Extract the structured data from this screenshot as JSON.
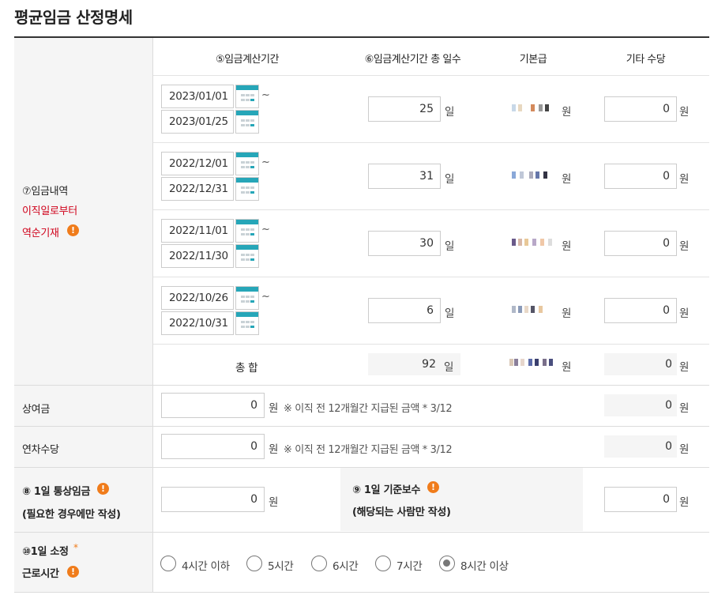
{
  "title": "평균임금 산정명세",
  "headers": {
    "period": "⑤임금계산기간",
    "days": "⑥임금계산기간 총 일수",
    "base_pay": "기본급",
    "other_allowance": "기타 수당"
  },
  "wage_section": {
    "label_line1": "⑦임금내역",
    "label_line2": "이직일로부터",
    "label_line3": "역순기재"
  },
  "periods": [
    {
      "start": "2023/01/01",
      "end": "2023/01/25",
      "days": "25",
      "other": "0"
    },
    {
      "start": "2022/12/01",
      "end": "2022/12/31",
      "days": "31",
      "other": "0"
    },
    {
      "start": "2022/11/01",
      "end": "2022/11/30",
      "days": "30",
      "other": "0"
    },
    {
      "start": "2022/10/26",
      "end": "2022/10/31",
      "days": "6",
      "other": "0"
    }
  ],
  "units": {
    "day": "일",
    "won": "원",
    "tilde": "~"
  },
  "total": {
    "label": "총 합",
    "days": "92",
    "other": "0"
  },
  "bonus": {
    "label": "상여금",
    "value": "0",
    "note": "※ 이직 전 12개월간 지급된 금액 * 3/12",
    "result": "0"
  },
  "annual_leave": {
    "label": "연차수당",
    "value": "0",
    "note": "※ 이직 전 12개월간 지급된 금액 * 3/12",
    "result": "0"
  },
  "daily_wage": {
    "label_line1": "⑧ 1일 통상임금",
    "label_line2": "(필요한 경우에만 작성)",
    "value": "0"
  },
  "daily_base": {
    "label_line1": "⑨ 1일 기준보수",
    "label_line2": "(해당되는 사람만 작성)",
    "value": "0"
  },
  "work_hours": {
    "label_line1": "⑩1일 소정",
    "label_line2": "근로시간",
    "star": "*",
    "options": [
      "4시간 이하",
      "5시간",
      "6시간",
      "7시간",
      "8시간 이상"
    ],
    "selected_index": 4
  },
  "icons": {
    "info": "!",
    "info_name": "warning-circle-icon",
    "calendar_name": "calendar-icon"
  },
  "colors": {
    "accent_orange": "#f07c1b",
    "calendar_teal": "#26a6b8",
    "required_red": "#d0021b"
  }
}
